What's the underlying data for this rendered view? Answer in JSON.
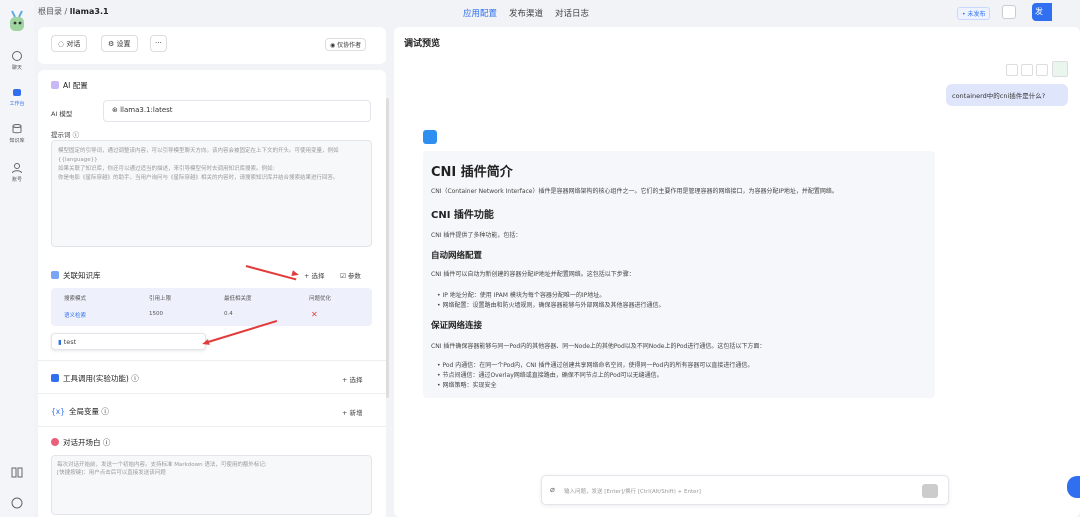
{
  "nav": {
    "items": [
      {
        "label": "聊天"
      },
      {
        "label": "工作台"
      },
      {
        "label": "知识库"
      },
      {
        "label": "账号"
      }
    ]
  },
  "header": {
    "breadcrumb_root": "根目录",
    "breadcrumb_sep": "/",
    "breadcrumb_current": "llama3.1",
    "tabs": [
      "应用配置",
      "发布渠道",
      "对话日志"
    ],
    "badge": "• 未发布",
    "publish": "发"
  },
  "toolbar": {
    "chat": "对话",
    "settings": "设置",
    "more": "···",
    "owner": "仅协作者"
  },
  "ai": {
    "title": "AI 配置",
    "model_label": "AI 模型",
    "model_value": "llama3.1:latest",
    "prompt_label": "提示词",
    "prompt_text": "模型固定的引导词，通过调整该内容，可以引导模型聊天方向。该内容会被固定在上下文的开头。可使用变量，例如 {{language}}\n如果关联了知识库，你还可以通过适当的描述，来引导模型何时去调用知识库搜索。例如:\n你是电影《星际穿越》的助手，当用户询问与《星际穿越》相关的内容时，请搜索知识库并结合搜索结果进行回答。"
  },
  "kb": {
    "title": "关联知识库",
    "select": "+ 选择",
    "params": "参数",
    "columns": [
      "搜索模式",
      "引用上限",
      "最低相关度",
      "问题优化"
    ],
    "row": [
      "语义检索",
      "1500",
      "0.4",
      "✕"
    ],
    "item": "test"
  },
  "tools": {
    "title": "工具调用(实验功能)",
    "action": "+ 选择"
  },
  "vars": {
    "title": "全局变量",
    "action": "+ 新增"
  },
  "opening": {
    "title": "对话开场白",
    "text": "每次对话开始前，发送一个初始内容。支持标准 Markdown 语法，可使用的额外标记:\n[快捷按键]：用户点击后可以直接发送该问题"
  },
  "preview": {
    "title": "调试预览",
    "question": "containerd中的cni插件是什么?"
  },
  "answer": {
    "h1": "CNI 插件简介",
    "p1": "CNI（Container Network Interface）插件是容器网络架构的核心组件之一。它们的主要作用是管理容器的网络接口，为容器分配IP地址，并配置网络。",
    "h2": "CNI 插件功能",
    "p2": "CNI 插件提供了多种功能，包括：",
    "h3a": "自动网络配置",
    "p3": "CNI 插件可以自动为新创建的容器分配IP地址并配置网络。这包括以下步骤：",
    "li1": "• IP 地址分配：使用 IPAM 模块为每个容器分配唯一的IP地址。",
    "li2": "• 网络配置：设置路由和防火墙规则，确保容器能够与外部网络及其他容器进行通信。",
    "h3b": "保证网络连接",
    "p4": "CNI 插件确保容器能够与同一Pod内的其他容器、同一Node上的其他Pod以及不同Node上的Pod进行通信。这包括以下方面：",
    "li3": "• Pod 内通信：在同一个Pod内，CNI 插件通过创建共享网络命名空间，使得同一Pod内的所有容器可以直接进行通信。",
    "li4": "• 节点间通信：通过Overlay网络或直接路由，确保不同节点上的Pod可以无缝通信。",
    "li5": "• 网络策略：实现安全"
  },
  "input": {
    "placeholder": "输入问题，发送 [Enter]/换行 [Ctrl(Alt/Shift) + Enter]"
  },
  "colors": {
    "accent": "#2f6ff0",
    "arrow": "#e23b3b"
  }
}
